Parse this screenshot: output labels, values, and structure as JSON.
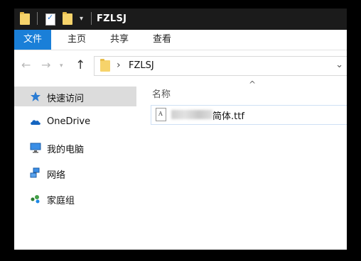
{
  "title": "FZLSJ",
  "ribbon": {
    "tabs": [
      "文件",
      "主页",
      "共享",
      "查看"
    ]
  },
  "address": {
    "breadcrumb": "FZLSJ"
  },
  "sidebar": {
    "items": [
      {
        "label": "快速访问",
        "icon": "star-icon"
      },
      {
        "label": "OneDrive",
        "icon": "cloud-icon"
      },
      {
        "label": "我的电脑",
        "icon": "computer-icon"
      },
      {
        "label": "网络",
        "icon": "network-icon"
      },
      {
        "label": "家庭组",
        "icon": "homegroup-icon"
      }
    ]
  },
  "main": {
    "column_header": "名称",
    "files": [
      {
        "name_visible": "简体.ttf",
        "type_icon": "font-file-icon"
      }
    ]
  },
  "colors": {
    "accent": "#1a7fd8",
    "titlebar": "#1b1b1b",
    "folder": "#f6d36b"
  }
}
